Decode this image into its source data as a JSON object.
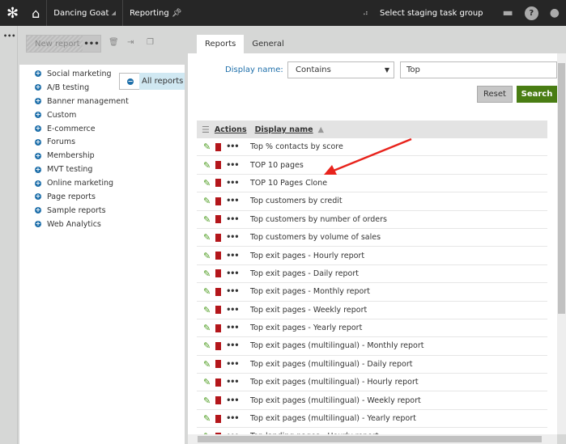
{
  "header": {
    "site": "Dancing Goat",
    "app": "Reporting",
    "staging": "Select staging task group"
  },
  "toolbar": {
    "new_report": "New report",
    "more": "•••"
  },
  "left_menu": "•••",
  "tree": {
    "root": "All reports",
    "items": [
      "Social marketing",
      "A/B testing",
      "Banner management",
      "Custom",
      "E-commerce",
      "Forums",
      "Membership",
      "MVT testing",
      "Online marketing",
      "Page reports",
      "Sample reports",
      "Web Analytics"
    ]
  },
  "tabs": [
    "Reports",
    "General"
  ],
  "filter": {
    "label": "Display name:",
    "operator": "Contains",
    "value": "Top",
    "reset": "Reset",
    "search": "Search"
  },
  "grid": {
    "col_actions": "Actions",
    "col_name": "Display name",
    "sort": "ascending",
    "rows": [
      "Top % contacts by score",
      "TOP 10 pages",
      "TOP 10 Pages Clone",
      "Top customers by credit",
      "Top customers by number of orders",
      "Top customers by volume of sales",
      "Top exit pages - Hourly report",
      "Top exit pages - Daily report",
      "Top exit pages - Monthly report",
      "Top exit pages - Weekly report",
      "Top exit pages - Yearly report",
      "Top exit pages (multilingual) - Monthly report",
      "Top exit pages (multilingual) - Daily report",
      "Top exit pages (multilingual) - Hourly report",
      "Top exit pages (multilingual) - Weekly report",
      "Top exit pages (multilingual) - Yearly report",
      "Top landing pages - Hourly report"
    ]
  },
  "colors": {
    "topbar": "#262626",
    "accent": "#1e6faa",
    "search": "#497d13",
    "delete": "#b4161b",
    "edit": "#4a9a1c",
    "annotation_arrow": "#e8231c"
  }
}
